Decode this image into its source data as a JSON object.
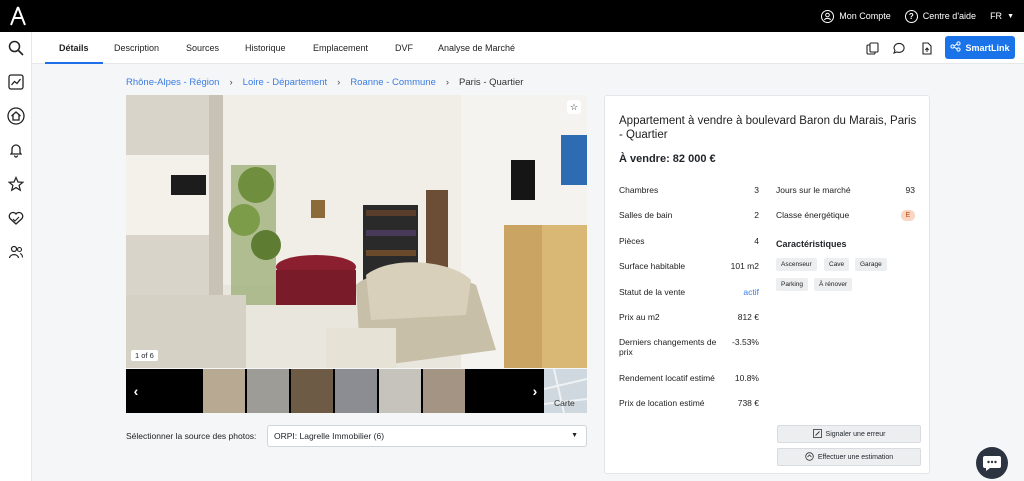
{
  "topbar": {
    "logo_icon": "a-logo-icon",
    "account_label": "Mon Compte",
    "help_label": "Centre d'aide",
    "lang_label": "FR"
  },
  "sidebar": {
    "items": [
      "search-icon",
      "chart-icon",
      "home-icon",
      "bell-icon",
      "star-icon",
      "handshake-heart-icon",
      "users-icon"
    ]
  },
  "tabs": [
    "Détails",
    "Description",
    "Sources",
    "Historique",
    "Emplacement",
    "DVF",
    "Analyse de Marché"
  ],
  "active_tab": "Détails",
  "toolbar": {
    "smartlink_label": "SmartLink"
  },
  "breadcrumb": [
    "Rhône-Alpes - Région",
    "Loire - Département",
    "Roanne - Commune",
    "Paris - Quartier"
  ],
  "gallery": {
    "counter": "1 of 6",
    "map_label": "Carte",
    "source_label": "Sélectionner la source des photos:",
    "source_value": "ORPI: Lagrelle Immobilier (6)"
  },
  "listing": {
    "title": "Appartement à vendre à boulevard Baron du Marais, Paris - Quartier",
    "price": "À vendre: 82 000 €",
    "left": [
      {
        "label": "Chambres",
        "value": "3"
      },
      {
        "label": "Salles de bain",
        "value": "2"
      },
      {
        "label": "Pièces",
        "value": "4"
      },
      {
        "label": "Surface habitable",
        "value": "101 m2"
      },
      {
        "label": "Statut de la vente",
        "value": "actif"
      },
      {
        "label": "Prix au m2",
        "value": "812 €"
      },
      {
        "label": "Derniers changements de prix",
        "value": "-3.53%"
      },
      {
        "label": "Rendement locatif estimé",
        "value": "10.8%"
      },
      {
        "label": "Prix de location estimé",
        "value": "738 €"
      }
    ],
    "right": [
      {
        "label": "Jours sur le marché",
        "value": "93"
      },
      {
        "label": "Classe énergétique",
        "value": "E"
      }
    ],
    "features_title": "Caractéristiques",
    "features": [
      "Ascenseur",
      "Cave",
      "Garage",
      "Parking",
      "À rénover"
    ],
    "report_error": "Signaler une erreur",
    "estimate": "Effectuer une estimation"
  },
  "colors": {
    "accent": "#1a73e8",
    "link": "#3b7de0",
    "energy_badge": "#f9d5c4"
  }
}
